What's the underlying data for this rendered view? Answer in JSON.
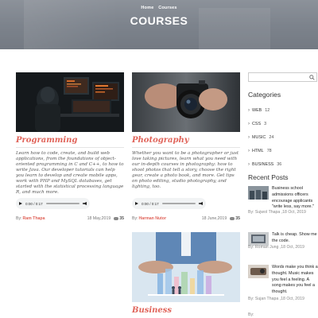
{
  "header": {
    "breadcrumb": [
      "Home",
      "Courses"
    ],
    "title": "COURSES"
  },
  "courses": [
    {
      "title": "Programming",
      "description": "Learn how to code, create, and build web applications, from the foundations of object-oriented programming in C and C++, to how to write Java. Our developer tutorials can help you learn to develop and create mobile apps, work with PHP and MySQL databases, get started with the statistical processing language R, and much more.",
      "audio_time": "0:00 / 0:17",
      "by_label": "By:",
      "author": "Ram Thapa",
      "date": "18 May,2019",
      "comments": "35"
    },
    {
      "title": "Photography",
      "description": "Whether you want to be a photographer or just love taking pictures, learn what you need with our in-depth courses in photography: how to shoot photos that tell a story, choose the right gear, create a photo book, and more. Get tips on photo editing, studio photography, and lighting, too.",
      "audio_time": "0:00 / 0:17",
      "by_label": "By:",
      "author": "Harman Nutor",
      "date": "18 June,2019",
      "comments": "35"
    },
    {
      "title": "Business"
    }
  ],
  "sidebar": {
    "search_placeholder": "",
    "categories_heading": "Categories",
    "categories": [
      {
        "name": "WEB",
        "count": "12"
      },
      {
        "name": "CSS",
        "count": "3"
      },
      {
        "name": "MUSIC",
        "count": "24"
      },
      {
        "name": "HTML",
        "count": "78"
      },
      {
        "name": "BUSINESS",
        "count": "36"
      }
    ],
    "recent_heading": "Recent Posts",
    "recent_posts": [
      {
        "title": "Business school admissions officers encourage applicants \"write less, say more.\"",
        "meta": "By: Sujwol Thapa ,18 Oct, 2019"
      },
      {
        "title": "Talk is cheap. Show me the code.",
        "meta": "By: Roman Jung ,18 Oct, 2019"
      },
      {
        "title": "Words make you think a thought. Music makes you feel a feeling. A song makes you feel a thought.",
        "meta": "By: Sujan Thapa ,18 Oct, 2019"
      }
    ],
    "bottom_partial": "By:"
  },
  "colors": {
    "accent": "#e0645a"
  },
  "icons": [
    "search-icon",
    "play-icon",
    "volume-icon",
    "comment-icon",
    "chevron-right-icon"
  ]
}
